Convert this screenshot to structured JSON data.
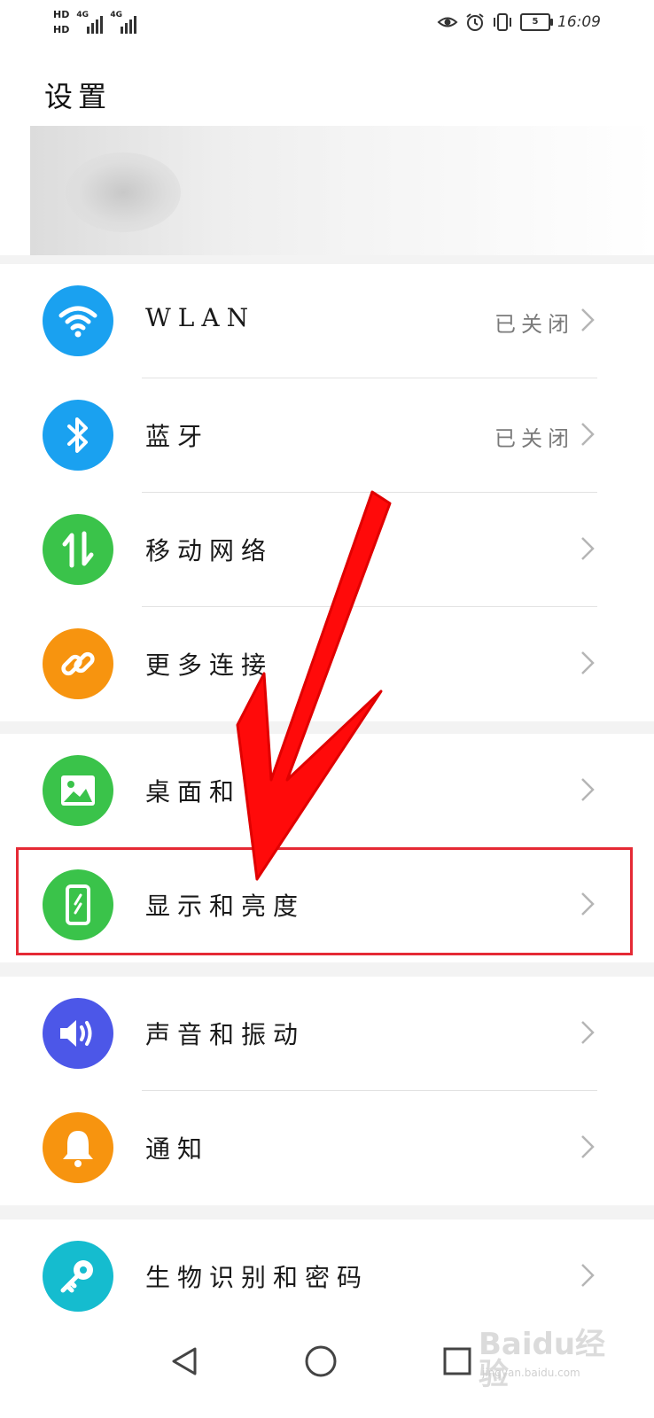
{
  "status_bar": {
    "sim1": "HD",
    "sim2": "HD",
    "net1": "4G",
    "net2": "4G",
    "time": "16:09",
    "battery": "5",
    "icons": [
      "eye-comfort-icon",
      "alarm-icon",
      "vibrate-icon",
      "battery-icon"
    ]
  },
  "header": {
    "title": "设置"
  },
  "settings": {
    "group1": [
      {
        "label": "WLAN",
        "value": "已关闭",
        "icon": "wifi-icon",
        "color": "#1aa1f0"
      },
      {
        "label": "蓝牙",
        "value": "已关闭",
        "icon": "bluetooth-icon",
        "color": "#1aa1f0"
      },
      {
        "label": "移动网络",
        "value": "",
        "icon": "mobile-data-icon",
        "color": "#3ac34a"
      },
      {
        "label": "更多连接",
        "value": "",
        "icon": "link-icon",
        "color": "#f7940f"
      }
    ],
    "group2": [
      {
        "label": "桌面和",
        "value": "",
        "icon": "wallpaper-icon",
        "color": "#3ac34a"
      },
      {
        "label": "显示和亮度",
        "value": "",
        "icon": "display-icon",
        "color": "#3ac34a",
        "highlighted": true
      }
    ],
    "group3": [
      {
        "label": "声音和振动",
        "value": "",
        "icon": "sound-icon",
        "color": "#4c57e8"
      },
      {
        "label": "通知",
        "value": "",
        "icon": "bell-icon",
        "color": "#f7940f"
      }
    ],
    "group4": [
      {
        "label": "生物识别和密码",
        "value": "",
        "icon": "key-icon",
        "color": "#15bccf"
      }
    ]
  },
  "annotation": {
    "arrow_color": "#ff0000",
    "box_color": "#e52a35"
  },
  "nav": [
    "back-icon",
    "home-icon",
    "recents-icon"
  ],
  "watermark": {
    "brand": "Baidu经验",
    "domain": "jingyan.baidu.com"
  }
}
